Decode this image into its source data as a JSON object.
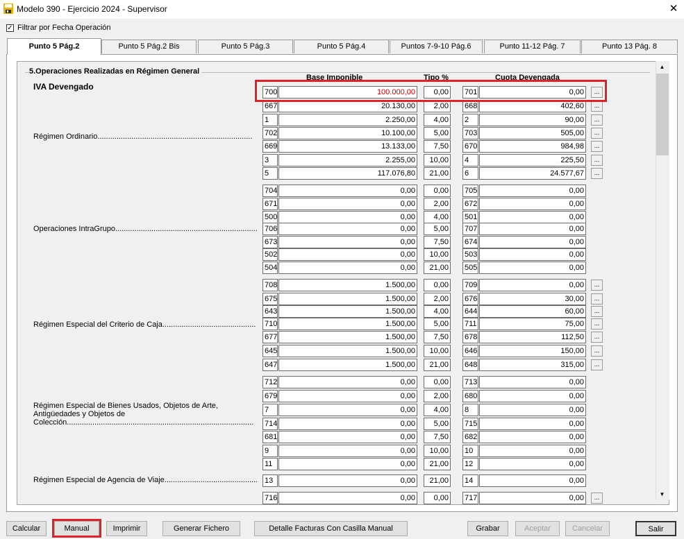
{
  "window": {
    "title": "Modelo 390 -  Ejercicio 2024 - Supervisor",
    "close": "✕"
  },
  "filter": {
    "label": "Filtrar por Fecha Operación",
    "checked": true,
    "mark": "✓"
  },
  "tabs": [
    {
      "label": "Punto 5 Pág.2",
      "active": true
    },
    {
      "label": "Punto 5 Pág.2 Bis"
    },
    {
      "label": "Punto 5 Pág.3"
    },
    {
      "label": "Punto 5 Pág.4"
    },
    {
      "label": "Puntos 7-9-10 Pág.6"
    },
    {
      "label": "Punto 11-12 Pág. 7"
    },
    {
      "label": "Punto 13 Pág. 8"
    }
  ],
  "section": {
    "title": "5.Operaciones Realizadas en Régimen General",
    "subtitle": "IVA Devengado",
    "headers": {
      "base": "Base Imponible",
      "tipo": "Tipo %",
      "cuota": "Cuota Devengada"
    }
  },
  "rows": [
    {
      "c1": "700",
      "base": "100.000,00",
      "tipo": "0,00",
      "c2": "701",
      "cuota": "0,00",
      "btn": true,
      "red": true
    },
    {
      "c1": "667",
      "base": "20.130,00",
      "tipo": "2,00",
      "c2": "668",
      "cuota": "402,60",
      "btn": true
    },
    {
      "c1": "1",
      "base": "2.250,00",
      "tipo": "4,00",
      "c2": "2",
      "cuota": "90,00",
      "btn": true
    },
    {
      "c1": "702",
      "base": "10.100,00",
      "tipo": "5,00",
      "c2": "703",
      "cuota": "505,00",
      "btn": true
    },
    {
      "c1": "669",
      "base": "13.133,00",
      "tipo": "7,50",
      "c2": "670",
      "cuota": "984,98",
      "btn": true
    },
    {
      "c1": "3",
      "base": "2.255,00",
      "tipo": "10,00",
      "c2": "4",
      "cuota": "225,50",
      "btn": true
    },
    {
      "c1": "5",
      "base": "117.076,80",
      "tipo": "21,00",
      "c2": "6",
      "cuota": "24.577,67",
      "btn": true
    },
    {
      "c1": "704",
      "base": "0,00",
      "tipo": "0,00",
      "c2": "705",
      "cuota": "0,00"
    },
    {
      "c1": "671",
      "base": "0,00",
      "tipo": "2,00",
      "c2": "672",
      "cuota": "0,00"
    },
    {
      "c1": "500",
      "base": "0,00",
      "tipo": "4,00",
      "c2": "501",
      "cuota": "0,00"
    },
    {
      "c1": "706",
      "base": "0,00",
      "tipo": "5,00",
      "c2": "707",
      "cuota": "0,00"
    },
    {
      "c1": "673",
      "base": "0,00",
      "tipo": "7,50",
      "c2": "674",
      "cuota": "0,00"
    },
    {
      "c1": "502",
      "base": "0,00",
      "tipo": "10,00",
      "c2": "503",
      "cuota": "0,00"
    },
    {
      "c1": "504",
      "base": "0,00",
      "tipo": "21,00",
      "c2": "505",
      "cuota": "0,00"
    },
    {
      "c1": "708",
      "base": "1.500,00",
      "tipo": "0,00",
      "c2": "709",
      "cuota": "0,00",
      "btn": true
    },
    {
      "c1": "675",
      "base": "1.500,00",
      "tipo": "2,00",
      "c2": "676",
      "cuota": "30,00",
      "btn": true
    },
    {
      "c1": "643",
      "base": "1.500,00",
      "tipo": "4,00",
      "c2": "644",
      "cuota": "60,00",
      "btn": true
    },
    {
      "c1": "710",
      "base": "1.500,00",
      "tipo": "5,00",
      "c2": "711",
      "cuota": "75,00",
      "btn": true
    },
    {
      "c1": "677",
      "base": "1.500,00",
      "tipo": "7,50",
      "c2": "678",
      "cuota": "112,50",
      "btn": true
    },
    {
      "c1": "645",
      "base": "1.500,00",
      "tipo": "10,00",
      "c2": "646",
      "cuota": "150,00",
      "btn": true
    },
    {
      "c1": "647",
      "base": "1.500,00",
      "tipo": "21,00",
      "c2": "648",
      "cuota": "315,00",
      "btn": true
    },
    {
      "c1": "712",
      "base": "0,00",
      "tipo": "0,00",
      "c2": "713",
      "cuota": "0,00"
    },
    {
      "c1": "679",
      "base": "0,00",
      "tipo": "2,00",
      "c2": "680",
      "cuota": "0,00"
    },
    {
      "c1": "7",
      "base": "0,00",
      "tipo": "4,00",
      "c2": "8",
      "cuota": "0,00"
    },
    {
      "c1": "714",
      "base": "0,00",
      "tipo": "5,00",
      "c2": "715",
      "cuota": "0,00"
    },
    {
      "c1": "681",
      "base": "0,00",
      "tipo": "7,50",
      "c2": "682",
      "cuota": "0,00"
    },
    {
      "c1": "9",
      "base": "0,00",
      "tipo": "10,00",
      "c2": "10",
      "cuota": "0,00"
    },
    {
      "c1": "11",
      "base": "0,00",
      "tipo": "21,00",
      "c2": "12",
      "cuota": "0,00"
    },
    {
      "c1": "13",
      "base": "0,00",
      "tipo": "21,00",
      "c2": "14",
      "cuota": "0,00"
    },
    {
      "c1": "716",
      "base": "0,00",
      "tipo": "0,00",
      "c2": "717",
      "cuota": "0,00",
      "btn": true
    }
  ],
  "edit_button_label": "...",
  "labels": [
    {
      "text": "Régimen Ordinario........................................................................."
    },
    {
      "text": "Operaciones IntraGrupo......................................................................"
    },
    {
      "text": "Régimen Especial del Criterio de Caja............................................"
    },
    {
      "text": "Régimen Especial de Bienes Usados, Objetos de Arte,\nAntigüedades y Objetos de\nColección........................................................................................"
    },
    {
      "text": "Régimen Especial de Agencia de Viaje............................................"
    }
  ],
  "buttons": [
    {
      "label": "Calcular"
    },
    {
      "label": "Manual"
    },
    {
      "label": "Imprimir"
    },
    {
      "label": "Generar Fichero"
    },
    {
      "label": "Detalle Facturas Con Casilla Manual"
    },
    {
      "label": "Grabar"
    },
    {
      "label": "Aceptar",
      "disabled": true
    },
    {
      "label": "Cancelar",
      "disabled": true
    },
    {
      "label": "Salir"
    }
  ],
  "scrollbar": {
    "up": "▲",
    "down": "▼"
  },
  "colors": {
    "highlight": "#e0202a",
    "red_value": "#d00000"
  }
}
